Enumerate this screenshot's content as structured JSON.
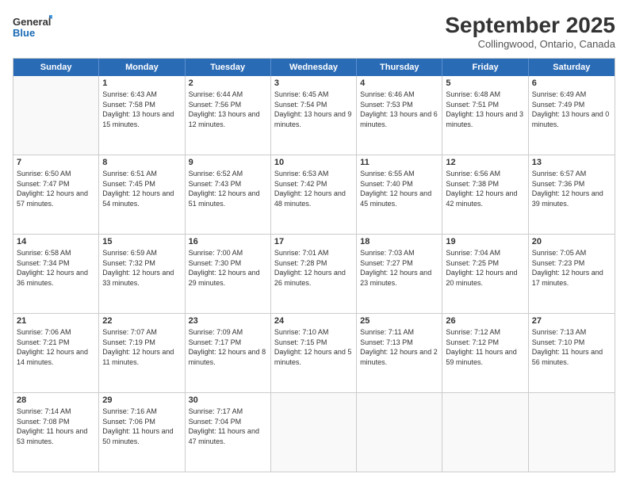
{
  "logo": {
    "line1": "General",
    "line2": "Blue"
  },
  "title": "September 2025",
  "subtitle": "Collingwood, Ontario, Canada",
  "header_days": [
    "Sunday",
    "Monday",
    "Tuesday",
    "Wednesday",
    "Thursday",
    "Friday",
    "Saturday"
  ],
  "weeks": [
    [
      {
        "day": "",
        "sunrise": "",
        "sunset": "",
        "daylight": ""
      },
      {
        "day": "1",
        "sunrise": "Sunrise: 6:43 AM",
        "sunset": "Sunset: 7:58 PM",
        "daylight": "Daylight: 13 hours and 15 minutes."
      },
      {
        "day": "2",
        "sunrise": "Sunrise: 6:44 AM",
        "sunset": "Sunset: 7:56 PM",
        "daylight": "Daylight: 13 hours and 12 minutes."
      },
      {
        "day": "3",
        "sunrise": "Sunrise: 6:45 AM",
        "sunset": "Sunset: 7:54 PM",
        "daylight": "Daylight: 13 hours and 9 minutes."
      },
      {
        "day": "4",
        "sunrise": "Sunrise: 6:46 AM",
        "sunset": "Sunset: 7:53 PM",
        "daylight": "Daylight: 13 hours and 6 minutes."
      },
      {
        "day": "5",
        "sunrise": "Sunrise: 6:48 AM",
        "sunset": "Sunset: 7:51 PM",
        "daylight": "Daylight: 13 hours and 3 minutes."
      },
      {
        "day": "6",
        "sunrise": "Sunrise: 6:49 AM",
        "sunset": "Sunset: 7:49 PM",
        "daylight": "Daylight: 13 hours and 0 minutes."
      }
    ],
    [
      {
        "day": "7",
        "sunrise": "Sunrise: 6:50 AM",
        "sunset": "Sunset: 7:47 PM",
        "daylight": "Daylight: 12 hours and 57 minutes."
      },
      {
        "day": "8",
        "sunrise": "Sunrise: 6:51 AM",
        "sunset": "Sunset: 7:45 PM",
        "daylight": "Daylight: 12 hours and 54 minutes."
      },
      {
        "day": "9",
        "sunrise": "Sunrise: 6:52 AM",
        "sunset": "Sunset: 7:43 PM",
        "daylight": "Daylight: 12 hours and 51 minutes."
      },
      {
        "day": "10",
        "sunrise": "Sunrise: 6:53 AM",
        "sunset": "Sunset: 7:42 PM",
        "daylight": "Daylight: 12 hours and 48 minutes."
      },
      {
        "day": "11",
        "sunrise": "Sunrise: 6:55 AM",
        "sunset": "Sunset: 7:40 PM",
        "daylight": "Daylight: 12 hours and 45 minutes."
      },
      {
        "day": "12",
        "sunrise": "Sunrise: 6:56 AM",
        "sunset": "Sunset: 7:38 PM",
        "daylight": "Daylight: 12 hours and 42 minutes."
      },
      {
        "day": "13",
        "sunrise": "Sunrise: 6:57 AM",
        "sunset": "Sunset: 7:36 PM",
        "daylight": "Daylight: 12 hours and 39 minutes."
      }
    ],
    [
      {
        "day": "14",
        "sunrise": "Sunrise: 6:58 AM",
        "sunset": "Sunset: 7:34 PM",
        "daylight": "Daylight: 12 hours and 36 minutes."
      },
      {
        "day": "15",
        "sunrise": "Sunrise: 6:59 AM",
        "sunset": "Sunset: 7:32 PM",
        "daylight": "Daylight: 12 hours and 33 minutes."
      },
      {
        "day": "16",
        "sunrise": "Sunrise: 7:00 AM",
        "sunset": "Sunset: 7:30 PM",
        "daylight": "Daylight: 12 hours and 29 minutes."
      },
      {
        "day": "17",
        "sunrise": "Sunrise: 7:01 AM",
        "sunset": "Sunset: 7:28 PM",
        "daylight": "Daylight: 12 hours and 26 minutes."
      },
      {
        "day": "18",
        "sunrise": "Sunrise: 7:03 AM",
        "sunset": "Sunset: 7:27 PM",
        "daylight": "Daylight: 12 hours and 23 minutes."
      },
      {
        "day": "19",
        "sunrise": "Sunrise: 7:04 AM",
        "sunset": "Sunset: 7:25 PM",
        "daylight": "Daylight: 12 hours and 20 minutes."
      },
      {
        "day": "20",
        "sunrise": "Sunrise: 7:05 AM",
        "sunset": "Sunset: 7:23 PM",
        "daylight": "Daylight: 12 hours and 17 minutes."
      }
    ],
    [
      {
        "day": "21",
        "sunrise": "Sunrise: 7:06 AM",
        "sunset": "Sunset: 7:21 PM",
        "daylight": "Daylight: 12 hours and 14 minutes."
      },
      {
        "day": "22",
        "sunrise": "Sunrise: 7:07 AM",
        "sunset": "Sunset: 7:19 PM",
        "daylight": "Daylight: 12 hours and 11 minutes."
      },
      {
        "day": "23",
        "sunrise": "Sunrise: 7:09 AM",
        "sunset": "Sunset: 7:17 PM",
        "daylight": "Daylight: 12 hours and 8 minutes."
      },
      {
        "day": "24",
        "sunrise": "Sunrise: 7:10 AM",
        "sunset": "Sunset: 7:15 PM",
        "daylight": "Daylight: 12 hours and 5 minutes."
      },
      {
        "day": "25",
        "sunrise": "Sunrise: 7:11 AM",
        "sunset": "Sunset: 7:13 PM",
        "daylight": "Daylight: 12 hours and 2 minutes."
      },
      {
        "day": "26",
        "sunrise": "Sunrise: 7:12 AM",
        "sunset": "Sunset: 7:12 PM",
        "daylight": "Daylight: 11 hours and 59 minutes."
      },
      {
        "day": "27",
        "sunrise": "Sunrise: 7:13 AM",
        "sunset": "Sunset: 7:10 PM",
        "daylight": "Daylight: 11 hours and 56 minutes."
      }
    ],
    [
      {
        "day": "28",
        "sunrise": "Sunrise: 7:14 AM",
        "sunset": "Sunset: 7:08 PM",
        "daylight": "Daylight: 11 hours and 53 minutes."
      },
      {
        "day": "29",
        "sunrise": "Sunrise: 7:16 AM",
        "sunset": "Sunset: 7:06 PM",
        "daylight": "Daylight: 11 hours and 50 minutes."
      },
      {
        "day": "30",
        "sunrise": "Sunrise: 7:17 AM",
        "sunset": "Sunset: 7:04 PM",
        "daylight": "Daylight: 11 hours and 47 minutes."
      },
      {
        "day": "",
        "sunrise": "",
        "sunset": "",
        "daylight": ""
      },
      {
        "day": "",
        "sunrise": "",
        "sunset": "",
        "daylight": ""
      },
      {
        "day": "",
        "sunrise": "",
        "sunset": "",
        "daylight": ""
      },
      {
        "day": "",
        "sunrise": "",
        "sunset": "",
        "daylight": ""
      }
    ]
  ]
}
